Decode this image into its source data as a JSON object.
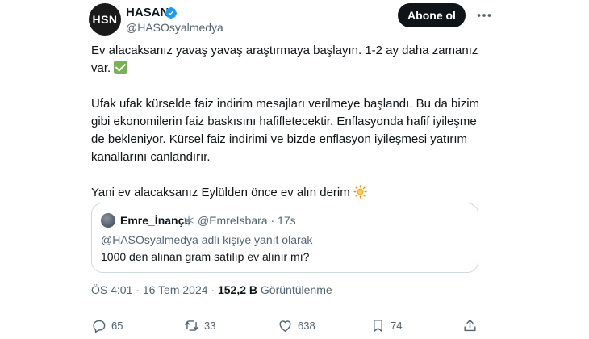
{
  "author": {
    "avatar_text": "HSN",
    "display_name": "HASAN",
    "handle": "@HASOsyalmedya",
    "verified": true
  },
  "follow_button": {
    "label": "Abone ol"
  },
  "tweet": {
    "paragraphs": [
      "Ev alacaksanız yavaş yavaş araştırmaya başlayın. 1-2 ay daha zamanız var.",
      "Ufak ufak kürselde faiz indirim mesajları verilmeye başlandı. Bu da bizim gibi ekonomilerin faiz baskısını hafifletecektir. Enflasyonda hafif iyileşme de bekleniyor. Kürsel faiz indirimi ve bizde enflasyon iyileşmesi yatırım kanallarını canlandırır.",
      "Yani ev alacaksanız Eylülden önce ev alın derim"
    ],
    "emoji": {
      "check": "check-mark-button-emoji",
      "sun": "sun-emoji"
    }
  },
  "quoted": {
    "display_name": "Emre_İnançu",
    "handle": "@EmreIsbara",
    "time": "17s",
    "reply_context": "@HASOsyalmedya adlı kişiye yanıt olarak",
    "text": "1000 den alınan gram satılıp ev alınır mı?"
  },
  "meta": {
    "time": "ÖS 4:01",
    "date": "16 Tem 2024",
    "views_count": "152,2 B",
    "views_label": "Görüntülenme"
  },
  "actions": {
    "replies": "65",
    "reposts": "33",
    "likes": "638",
    "bookmarks": "74"
  },
  "colors": {
    "text": "#0f1419",
    "muted": "#536471",
    "verified": "#1d9bf0",
    "border": "#cfd9de",
    "button": "#0f1419"
  }
}
